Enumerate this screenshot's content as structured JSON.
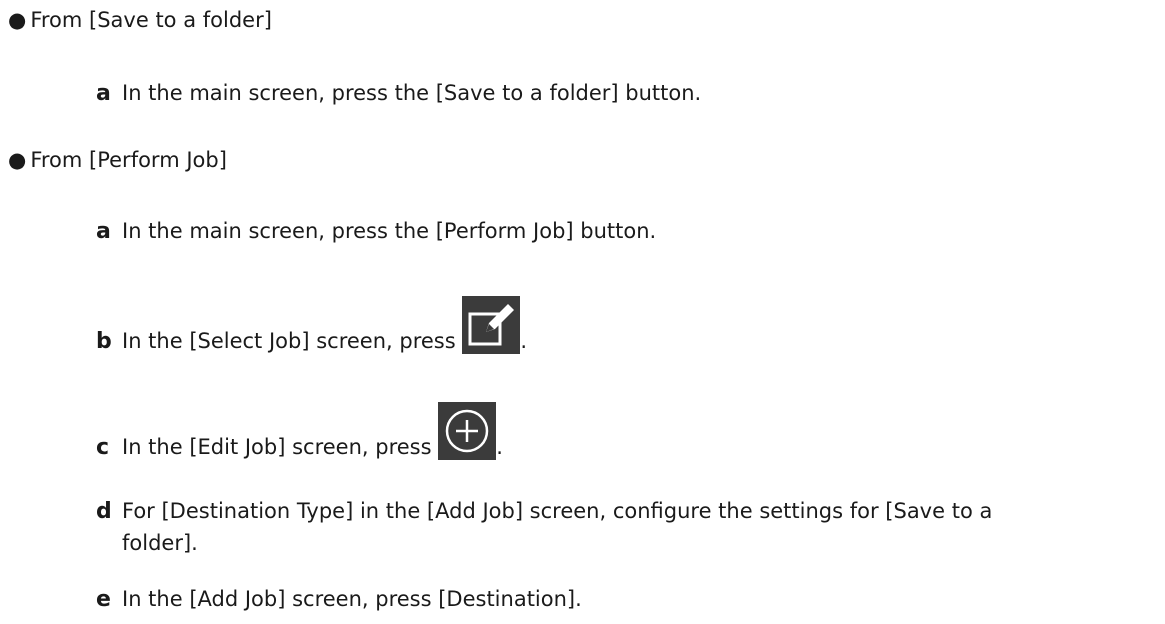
{
  "sections": [
    {
      "bullet": "●",
      "title": "From [Save to a folder]",
      "steps": [
        {
          "letter": "a",
          "text": "In the main screen, press the [Save to a folder] button."
        }
      ]
    },
    {
      "bullet": "●",
      "title": "From [Perform Job]",
      "steps": [
        {
          "letter": "a",
          "text": "In the main screen, press the [Perform Job] button."
        },
        {
          "letter": "b",
          "text": "In the [Select Job] screen, press",
          "icon": "edit-icon",
          "suffix": "."
        },
        {
          "letter": "c",
          "text": "In the [Edit Job] screen, press",
          "icon": "add-circle-icon",
          "suffix": "."
        },
        {
          "letter": "d",
          "text_line1": "For [Destination Type] in the [Add Job] screen, configure the settings for [Save to a",
          "text_line2": "folder]."
        },
        {
          "letter": "e",
          "text": "In the [Add Job] screen, press [Destination]."
        }
      ]
    }
  ]
}
